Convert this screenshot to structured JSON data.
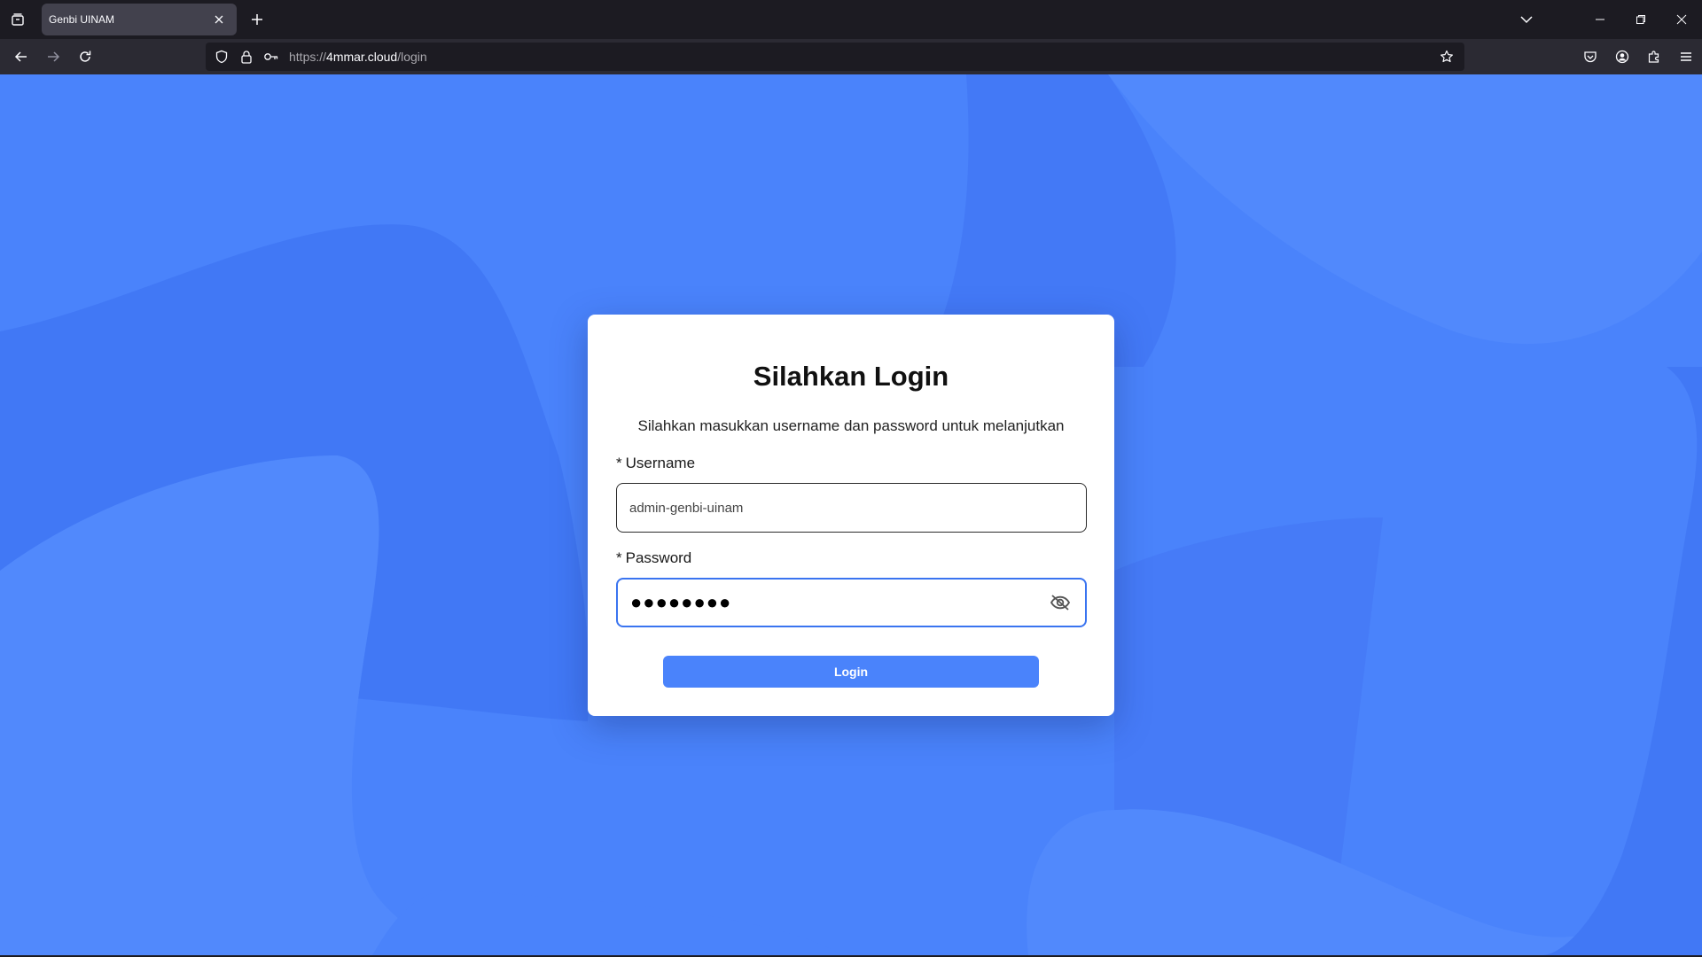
{
  "browser": {
    "tab": {
      "title": "Genbi UINAM"
    },
    "url": {
      "scheme": "https://",
      "host": "4mmar.cloud",
      "path": "/login"
    },
    "icons": {
      "list_tabs": "list-all-tabs-icon",
      "close_tab": "close-icon",
      "new_tab": "plus-icon",
      "overflow": "chevron-down-icon",
      "back": "arrow-left-icon",
      "forward": "arrow-right-icon",
      "reload": "reload-icon",
      "shield": "tracking-protection-shield-icon",
      "lock": "lock-icon",
      "key": "key-icon",
      "bookmark": "star-icon",
      "pocket": "pocket-icon",
      "account": "account-icon",
      "extensions": "puzzle-icon",
      "menu": "hamburger-menu-icon"
    }
  },
  "login": {
    "title": "Silahkan Login",
    "subtitle": "Silahkan masukkan username dan password untuk melanjutkan",
    "required_marker": "*",
    "username_label": "Username",
    "username_value": "admin-genbi-uinam",
    "password_label": "Password",
    "password_value": "●●●●●●●●",
    "password_toggle_icon": "eye-slash-icon",
    "submit_label": "Login"
  },
  "colors": {
    "page_background": "#4a83fb",
    "primary_button": "#4a83fb",
    "focus_ring": "#3a74f0",
    "card": "#ffffff"
  }
}
